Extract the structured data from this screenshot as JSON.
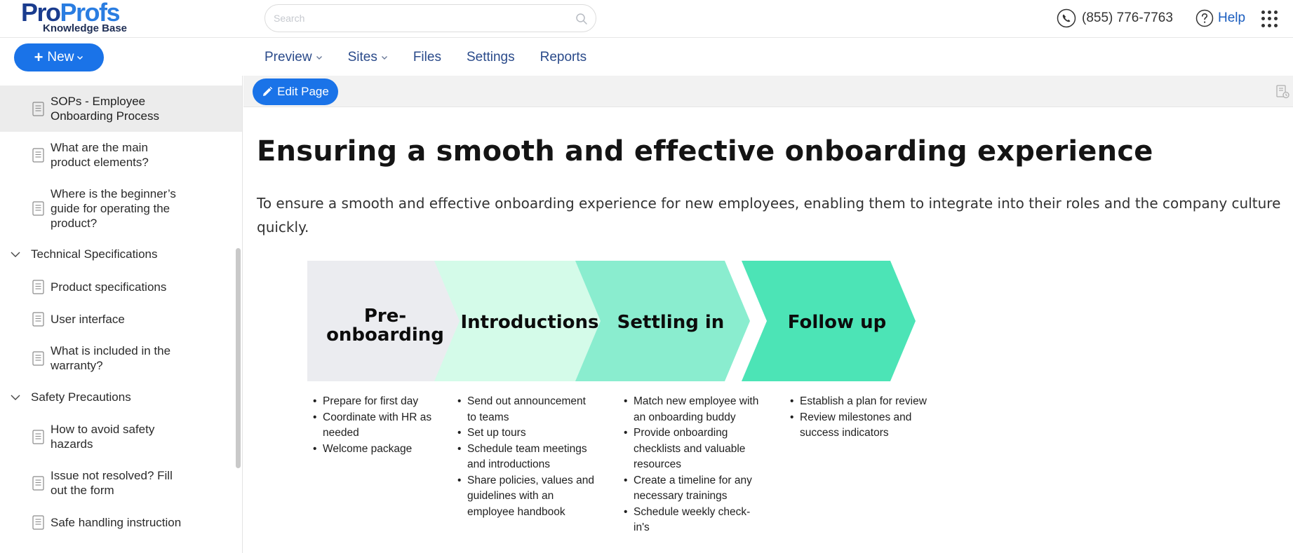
{
  "brand": {
    "logo_part1": "Pro",
    "logo_part2": "Profs",
    "logo_sub": "Knowledge Base"
  },
  "header": {
    "search_placeholder": "Search",
    "phone": "(855) 776-7763",
    "help_label": "Help"
  },
  "nav": {
    "new_label": "New",
    "items": [
      {
        "label": "Preview",
        "has_dropdown": true
      },
      {
        "label": "Sites",
        "has_dropdown": true
      },
      {
        "label": "Files",
        "has_dropdown": false
      },
      {
        "label": "Settings",
        "has_dropdown": false
      },
      {
        "label": "Reports",
        "has_dropdown": false
      }
    ]
  },
  "sidebar": {
    "items": [
      {
        "type": "page",
        "label": "SOPs - Employee Onboarding Process",
        "active": true
      },
      {
        "type": "page",
        "label": "What are the main product elements?"
      },
      {
        "type": "page",
        "label": "Where is the beginner’s guide for operating the product?"
      },
      {
        "type": "category",
        "label": "Technical Specifications",
        "expanded": true
      },
      {
        "type": "page",
        "label": "Product specifications"
      },
      {
        "type": "page",
        "label": "User interface"
      },
      {
        "type": "page",
        "label": "What is included in the warranty?"
      },
      {
        "type": "category",
        "label": "Safety Precautions",
        "expanded": true
      },
      {
        "type": "page",
        "label": "How to avoid safety hazards"
      },
      {
        "type": "page",
        "label": "Issue not resolved? Fill out the form"
      },
      {
        "type": "page",
        "label": "Safe handling instruction"
      }
    ]
  },
  "toolbar": {
    "edit_label": "Edit Page"
  },
  "article": {
    "title": "Ensuring a smooth and effective onboarding experience",
    "description": "To ensure a smooth and effective onboarding experience for new employees, enabling them to integrate into their roles and the company culture quickly."
  },
  "infographic": {
    "colors": [
      "#ebecf0",
      "#d4fbe9",
      "#8aedcf",
      "#4ce4b6"
    ],
    "stages": [
      {
        "title": "Pre-onboarding",
        "title_lines": [
          "Pre-",
          "onboarding"
        ],
        "bullets": [
          "Prepare for first day",
          "Coordinate with HR as needed",
          "Welcome package"
        ]
      },
      {
        "title": "Introductions",
        "title_lines": [
          "Introductions"
        ],
        "bullets": [
          "Send out announcement to teams",
          "Set up tours",
          "Schedule team meetings and introductions",
          "Share policies, values and guidelines with an employee handbook"
        ]
      },
      {
        "title": "Settling in",
        "title_lines": [
          "Settling in"
        ],
        "bullets": [
          "Match new employee with an onboarding buddy",
          "Provide onboarding checklists and valuable resources",
          "Create a timeline for any necessary trainings",
          "Schedule weekly check-in's"
        ]
      },
      {
        "title": "Follow up",
        "title_lines": [
          "Follow up"
        ],
        "bullets": [
          "Establish a plan for review",
          "Review milestones and success indicators"
        ]
      }
    ]
  }
}
